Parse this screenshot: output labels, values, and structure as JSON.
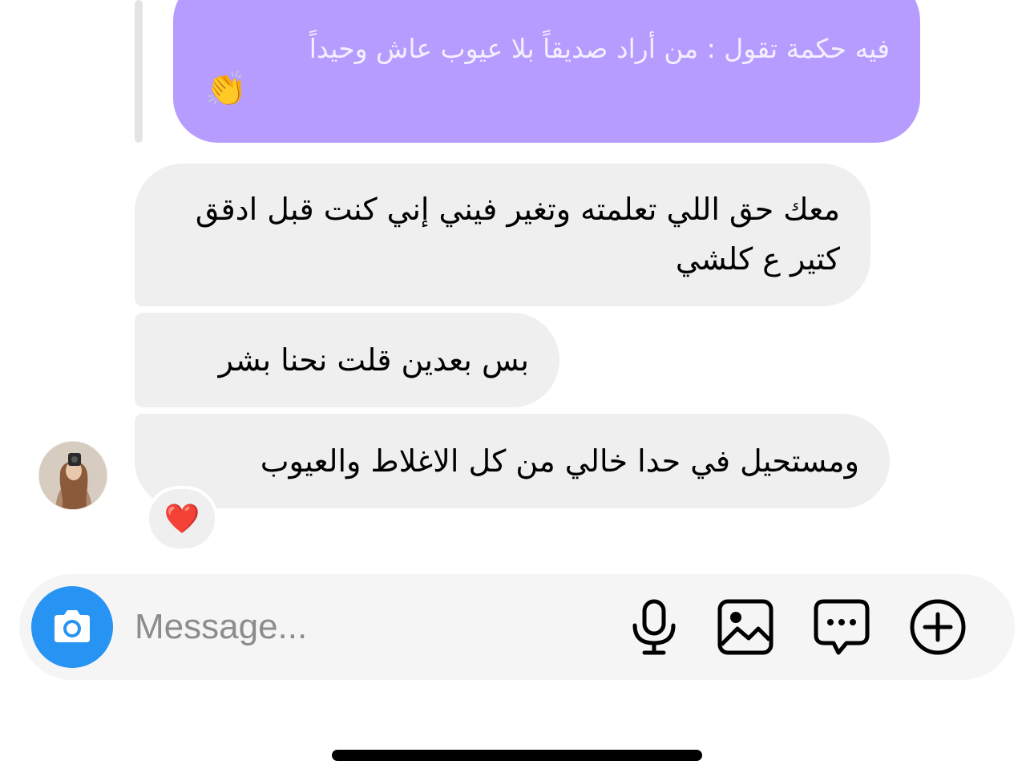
{
  "conversation": {
    "reply_preview": {
      "text": "فيه حكمة تقول : من أراد صديقاً بلا عيوب عاش وحيداً",
      "emoji": "👏"
    },
    "messages": [
      {
        "text": "معك حق اللي تعلمته وتغير فيني إني كنت قبل ادقق كتير ع كلشي"
      },
      {
        "text": "بس بعدين قلت نحنا بشر"
      },
      {
        "text": "ومستحيل في حدا خالي من كل الاغلاط والعيوب"
      }
    ],
    "reaction": "❤️"
  },
  "composer": {
    "placeholder": "Message...",
    "icons": [
      "camera-icon",
      "microphone-icon",
      "gallery-icon",
      "sticker-icon",
      "plus-icon"
    ],
    "camera_color": "#2793f2"
  },
  "colors": {
    "sent_bubble": "#b69cff",
    "received_bubble": "#efefef"
  }
}
